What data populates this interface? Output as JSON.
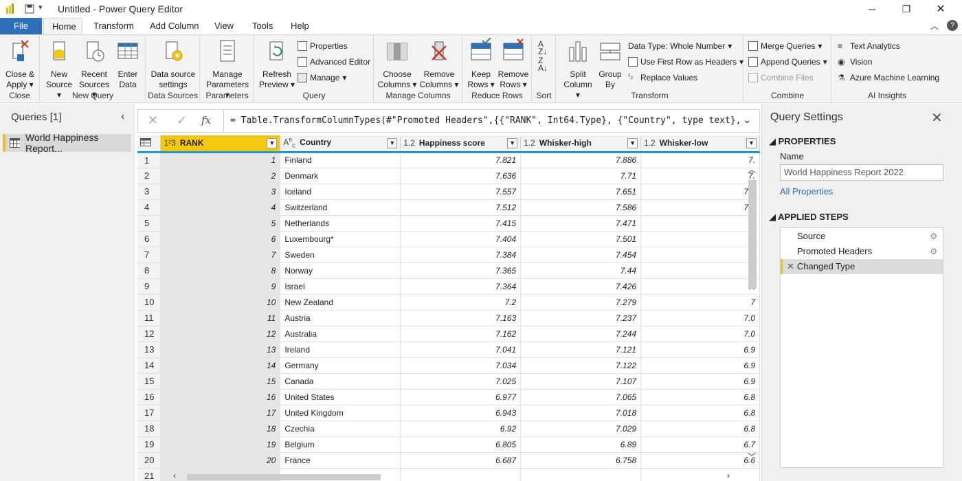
{
  "window": {
    "title": "Untitled - Power Query Editor"
  },
  "tabs": [
    "File",
    "Home",
    "Transform",
    "Add Column",
    "View",
    "Tools",
    "Help"
  ],
  "ribbon": {
    "close_group": {
      "label": "Close",
      "close_apply": "Close &",
      "close_apply2": "Apply"
    },
    "new_query_group": {
      "label": "New Query",
      "new_source": "New",
      "new_source2": "Source",
      "recent_sources": "Recent",
      "recent_sources2": "Sources",
      "enter_data": "Enter",
      "enter_data2": "Data"
    },
    "data_sources_group": {
      "label": "Data Sources",
      "settings": "Data source",
      "settings2": "settings"
    },
    "parameters_group": {
      "label": "Parameters",
      "manage": "Manage",
      "manage2": "Parameters"
    },
    "query_group": {
      "label": "Query",
      "refresh": "Refresh",
      "refresh2": "Preview",
      "properties": "Properties",
      "advanced_editor": "Advanced Editor",
      "manage": "Manage"
    },
    "manage_columns_group": {
      "label": "Manage Columns",
      "choose": "Choose",
      "choose2": "Columns",
      "remove": "Remove",
      "remove2": "Columns"
    },
    "reduce_rows_group": {
      "label": "Reduce Rows",
      "keep": "Keep",
      "keep2": "Rows",
      "remove": "Remove",
      "remove2": "Rows"
    },
    "sort_group": {
      "label": "Sort"
    },
    "transform_group": {
      "label": "Transform",
      "split": "Split",
      "split2": "Column",
      "group": "Group",
      "group2": "By",
      "data_type": "Data Type: Whole Number",
      "first_row": "Use First Row as Headers",
      "replace": "Replace Values"
    },
    "combine_group": {
      "label": "Combine",
      "merge": "Merge Queries",
      "append": "Append Queries",
      "combine_files": "Combine Files"
    },
    "ai_group": {
      "label": "AI Insights",
      "text_analytics": "Text Analytics",
      "vision": "Vision",
      "azure_ml": "Azure Machine Learning"
    }
  },
  "queries_panel": {
    "title": "Queries [1]",
    "items": [
      "World Happiness Report..."
    ]
  },
  "formula_bar": {
    "formula": "= Table.TransformColumnTypes(#\"Promoted Headers\",{{\"RANK\", Int64.Type}, {\"Country\", type text},"
  },
  "grid": {
    "columns": [
      {
        "type": "1²3",
        "name": "RANK"
      },
      {
        "type": "A^B_C",
        "name": "Country"
      },
      {
        "type": "1.2",
        "name": "Happiness score"
      },
      {
        "type": "1.2",
        "name": "Whisker-high"
      },
      {
        "type": "1.2",
        "name": "Whisker-low"
      }
    ],
    "rows": [
      [
        "1",
        "1",
        "Finland",
        "7.821",
        "7.886",
        "7."
      ],
      [
        "2",
        "2",
        "Denmark",
        "7.636",
        "7.71",
        "7."
      ],
      [
        "3",
        "3",
        "Iceland",
        "7.557",
        "7.651",
        "7.4"
      ],
      [
        "4",
        "4",
        "Switzerland",
        "7.512",
        "7.586",
        "7.4"
      ],
      [
        "5",
        "5",
        "Netherlands",
        "7.415",
        "7.471",
        "7."
      ],
      [
        "6",
        "6",
        "Luxembourg*",
        "7.404",
        "7.501",
        "7."
      ],
      [
        "7",
        "7",
        "Sweden",
        "7.384",
        "7.454",
        "7."
      ],
      [
        "8",
        "8",
        "Norway",
        "7.365",
        "7.44",
        "7"
      ],
      [
        "9",
        "9",
        "Israel",
        "7.364",
        "7.426",
        "7."
      ],
      [
        "10",
        "10",
        "New Zealand",
        "7.2",
        "7.279",
        "7"
      ],
      [
        "11",
        "11",
        "Austria",
        "7.163",
        "7.237",
        "7.0"
      ],
      [
        "12",
        "12",
        "Australia",
        "7.162",
        "7.244",
        "7.0"
      ],
      [
        "13",
        "13",
        "Ireland",
        "7.041",
        "7.121",
        "6.9"
      ],
      [
        "14",
        "14",
        "Germany",
        "7.034",
        "7.122",
        "6.9"
      ],
      [
        "15",
        "15",
        "Canada",
        "7.025",
        "7.107",
        "6.9"
      ],
      [
        "16",
        "16",
        "United States",
        "6.977",
        "7.065",
        "6.8"
      ],
      [
        "17",
        "17",
        "United Kingdom",
        "6.943",
        "7.018",
        "6.8"
      ],
      [
        "18",
        "18",
        "Czechia",
        "6.92",
        "7.029",
        "6.8"
      ],
      [
        "19",
        "19",
        "Belgium",
        "6.805",
        "6.89",
        "6.7"
      ],
      [
        "20",
        "20",
        "France",
        "6.687",
        "6.758",
        "6.6"
      ],
      [
        "21",
        "",
        "",
        "",
        "",
        ""
      ]
    ]
  },
  "query_settings": {
    "title": "Query Settings",
    "properties_header": "PROPERTIES",
    "name_label": "Name",
    "name_value": "World Happiness Report 2022",
    "all_properties": "All Properties",
    "steps_header": "APPLIED STEPS",
    "steps": [
      "Source",
      "Promoted Headers",
      "Changed Type"
    ]
  },
  "colors": {
    "accent": "#2f6fb7",
    "highlight": "#f2c811",
    "header_line": "#1f9ad6"
  }
}
